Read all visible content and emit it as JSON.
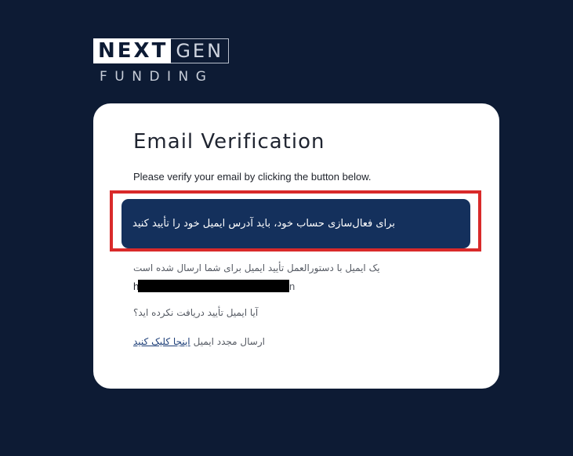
{
  "logo": {
    "part1": "NEXT",
    "part2": "GEN",
    "part3": "FUNDING"
  },
  "card": {
    "title": "Email Verification",
    "subtitle": "Please verify your email by clicking the button below.",
    "verify_button": "برای فعال‌سازی حساب خود، باید آدرس ایمیل خود را تأیید کنید",
    "sent_message": "یک ایمیل با دستورالعمل تأیید ایمیل برای شما ارسال شده است",
    "email_visible_start": "h",
    "email_visible_end": "n.",
    "not_received": "آیا ایمیل تأیید دریافت نکرده اید؟",
    "resend_link": "اینجا کلیک کنید",
    "resend_text": "ارسال مجدد ایمیل"
  },
  "colors": {
    "background": "#0d1b34",
    "button": "#14305c",
    "highlight": "#d92a2a",
    "link": "#1e3f78"
  }
}
